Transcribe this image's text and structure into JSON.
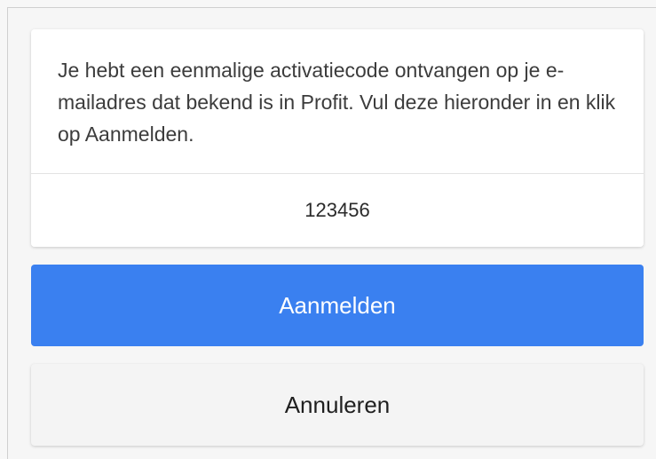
{
  "activation": {
    "message": "Je hebt een eenmalige activatiecode ontvangen op je e-mailadres dat bekend is in Profit. Vul deze hieronder in en klik op Aanmelden.",
    "code_value": "123456"
  },
  "actions": {
    "login_label": "Aanmelden",
    "cancel_label": "Annuleren"
  },
  "colors": {
    "primary": "#3a80f0",
    "secondary_bg": "#f4f4f4",
    "card_bg": "#ffffff"
  }
}
